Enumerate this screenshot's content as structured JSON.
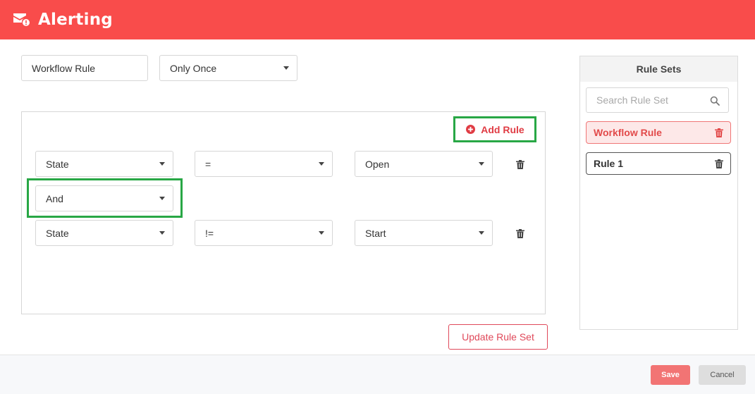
{
  "header": {
    "title": "Alerting",
    "icon": "mail-alert-icon",
    "color": "#f94c4b"
  },
  "top": {
    "rule_name": "Workflow Rule",
    "frequency": "Only Once"
  },
  "rule_builder": {
    "add_rule_label": "Add Rule",
    "rows": [
      {
        "field": "State",
        "operator": "=",
        "value": "Open"
      },
      {
        "field": "State",
        "operator": "!=",
        "value": "Start"
      }
    ],
    "connector": "And"
  },
  "update_label": "Update Rule Set",
  "rule_sets": {
    "title": "Rule Sets",
    "search_placeholder": "Search Rule Set",
    "items": [
      {
        "label": "Workflow Rule",
        "active": true
      },
      {
        "label": "Rule 1",
        "active": false
      }
    ]
  },
  "footer": {
    "save_label": "Save",
    "cancel_label": "Cancel"
  }
}
